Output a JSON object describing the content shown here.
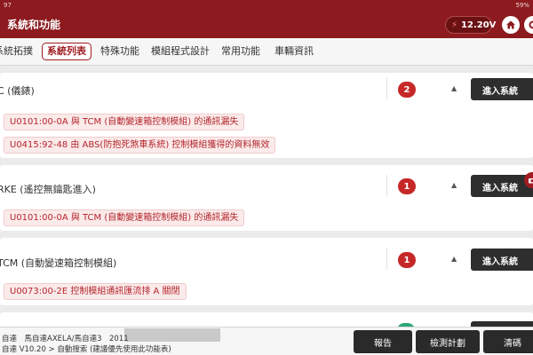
{
  "status_bar": {
    "left_text": "97",
    "battery": "59%"
  },
  "header": {
    "title": "系統和功能",
    "voltage": "12.20V",
    "home_icon": "home-icon",
    "other_icon": "gear-icon"
  },
  "tabs": [
    {
      "label": "系統拓撲",
      "active": false
    },
    {
      "label": "系統列表",
      "active": true
    },
    {
      "label": "特殊功能",
      "active": false
    },
    {
      "label": "模組程式設計",
      "active": false
    },
    {
      "label": "常用功能",
      "active": false
    },
    {
      "label": "車輛資訊",
      "active": false
    }
  ],
  "systems": [
    {
      "name": "C (儀錶)",
      "fault_count": "2",
      "expand_icon": "triangle-up-icon",
      "enter_label": "進入系統",
      "dtcs": [
        "U0101:00-0A 與 TCM (自動變速箱控制模組) 的通訊漏失",
        "U0415:92-48 由 ABS(防抱死煞車系統) 控制模組獲得的資料無效"
      ]
    },
    {
      "name": "RKE (遙控無鑰匙進入)",
      "fault_count": "1",
      "expand_icon": "triangle-up-icon",
      "enter_label": "進入系統",
      "dtcs": [
        "U0101:00-0A 與 TCM (自動變速箱控制模組) 的通訊漏失"
      ]
    },
    {
      "name": "TCM (自動變速箱控制模組)",
      "fault_count": "1",
      "expand_icon": "triangle-up-icon",
      "enter_label": "進入系統",
      "dtcs": [
        "U0073:00-2E 控制模組通訊匯流排 A 關閉"
      ]
    }
  ],
  "footer": {
    "vehicle_line": "自達　馬自達AXELA/馬自達3　2011",
    "version_line": "自達 V10.20 > 自動搜索 (建議優先使用此功能表)",
    "buttons": [
      "報告",
      "檢測計劃",
      "清碼"
    ]
  },
  "colors": {
    "brand": "#8c1a1e",
    "fault_badge": "#c62828",
    "dtc_text": "#b3262c",
    "button_dark": "#2e2e2e"
  }
}
